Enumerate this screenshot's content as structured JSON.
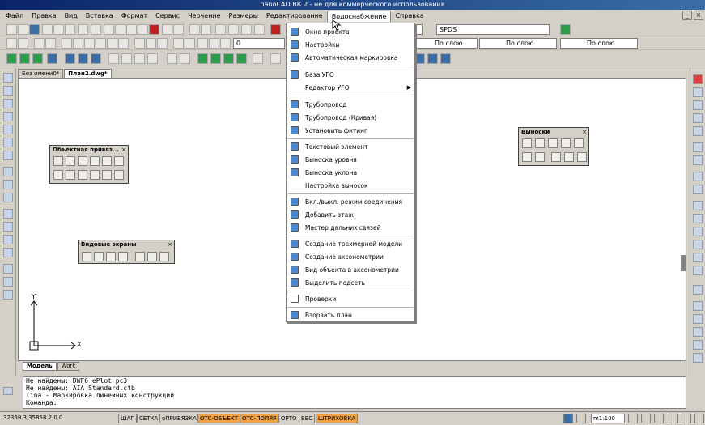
{
  "title": "nanoCAD ВК 2 - не для коммерческого использования",
  "menubar": {
    "items": [
      "Файл",
      "Правка",
      "Вид",
      "Вставка",
      "Формат",
      "Сервис",
      "Черчение",
      "Размеры",
      "Редактирование",
      "Водоснабжение",
      "Справка"
    ],
    "active": "Водоснабжение"
  },
  "toolbar": {
    "layer_value": "0",
    "style_value": "SPDS",
    "linetype_value": "По слою",
    "lineweight_value": "По слою",
    "color_value": "По слою"
  },
  "doc_tabs": [
    "Без имени0*",
    "План2.dwg*"
  ],
  "layout_tabs": [
    "Модель",
    "Work"
  ],
  "panels": {
    "snaps": "Объектная привяз...",
    "views": "Видовые экраны",
    "leaders": "Выноски"
  },
  "dropdown": {
    "items": [
      {
        "label": "Окно проекта",
        "icon": "project-window-icon"
      },
      {
        "label": "Настройки",
        "icon": "settings-icon"
      },
      {
        "label": "Автоматическая маркировка",
        "icon": "auto-marking-icon"
      },
      {
        "label": "База УГО",
        "icon": "ugo-database-icon"
      },
      {
        "label": "Редактор УГО",
        "icon": "ugo-editor-icon",
        "submenu": true
      },
      {
        "label": "Трубопровод",
        "icon": "pipeline-icon"
      },
      {
        "label": "Трубопровод (Кривая)",
        "icon": "pipeline-curve-icon"
      },
      {
        "label": "Установить фитинг",
        "icon": "fitting-icon"
      },
      {
        "label": "Текстовый элемент",
        "icon": "text-element-icon"
      },
      {
        "label": "Выноска уровня",
        "icon": "level-leader-icon"
      },
      {
        "label": "Выноска уклона",
        "icon": "slope-leader-icon"
      },
      {
        "label": "Настройка выносок",
        "icon": "leader-settings-icon"
      },
      {
        "label": "Вкл./выкл. режим соединения",
        "icon": "connection-mode-icon"
      },
      {
        "label": "Добавить этаж",
        "icon": "add-floor-icon"
      },
      {
        "label": "Мастер дальних связей",
        "icon": "long-links-icon"
      },
      {
        "label": "Создание трехмерной модели",
        "icon": "3d-model-icon"
      },
      {
        "label": "Создание аксонометрии",
        "icon": "axonometry-icon"
      },
      {
        "label": "Вид объекта в аксонометрии",
        "icon": "axonometry-view-icon"
      },
      {
        "label": "Выделить подсеть",
        "icon": "select-subnet-icon"
      },
      {
        "label": "Проверки",
        "icon": "checks-icon"
      },
      {
        "label": "Взорвать план",
        "icon": "explode-plan-icon"
      }
    ]
  },
  "command_lines": [
    "Не найдены: DWF6 ePlot pc3",
    "Не найдены: AIA Standard.ctb",
    "lina - Маркировка линейных конструкций",
    "Команда:"
  ],
  "status": {
    "coords": "32369.3,35858.2,0.0",
    "toggles": [
      {
        "label": "ШАГ",
        "on": false
      },
      {
        "label": "СЕТКА",
        "on": false
      },
      {
        "label": "оПРИВЯЗКА",
        "on": false
      },
      {
        "label": "ОТС-ОБЪЕКТ",
        "on": true
      },
      {
        "label": "ОТС-ПОЛЯР",
        "on": true
      },
      {
        "label": "ОРТО",
        "on": false
      },
      {
        "label": "ВЕС",
        "on": false
      },
      {
        "label": "ШТРИХОВКА",
        "on": true
      }
    ],
    "scale": "m1:100"
  },
  "ucs": {
    "x": "X",
    "y": "Y"
  }
}
